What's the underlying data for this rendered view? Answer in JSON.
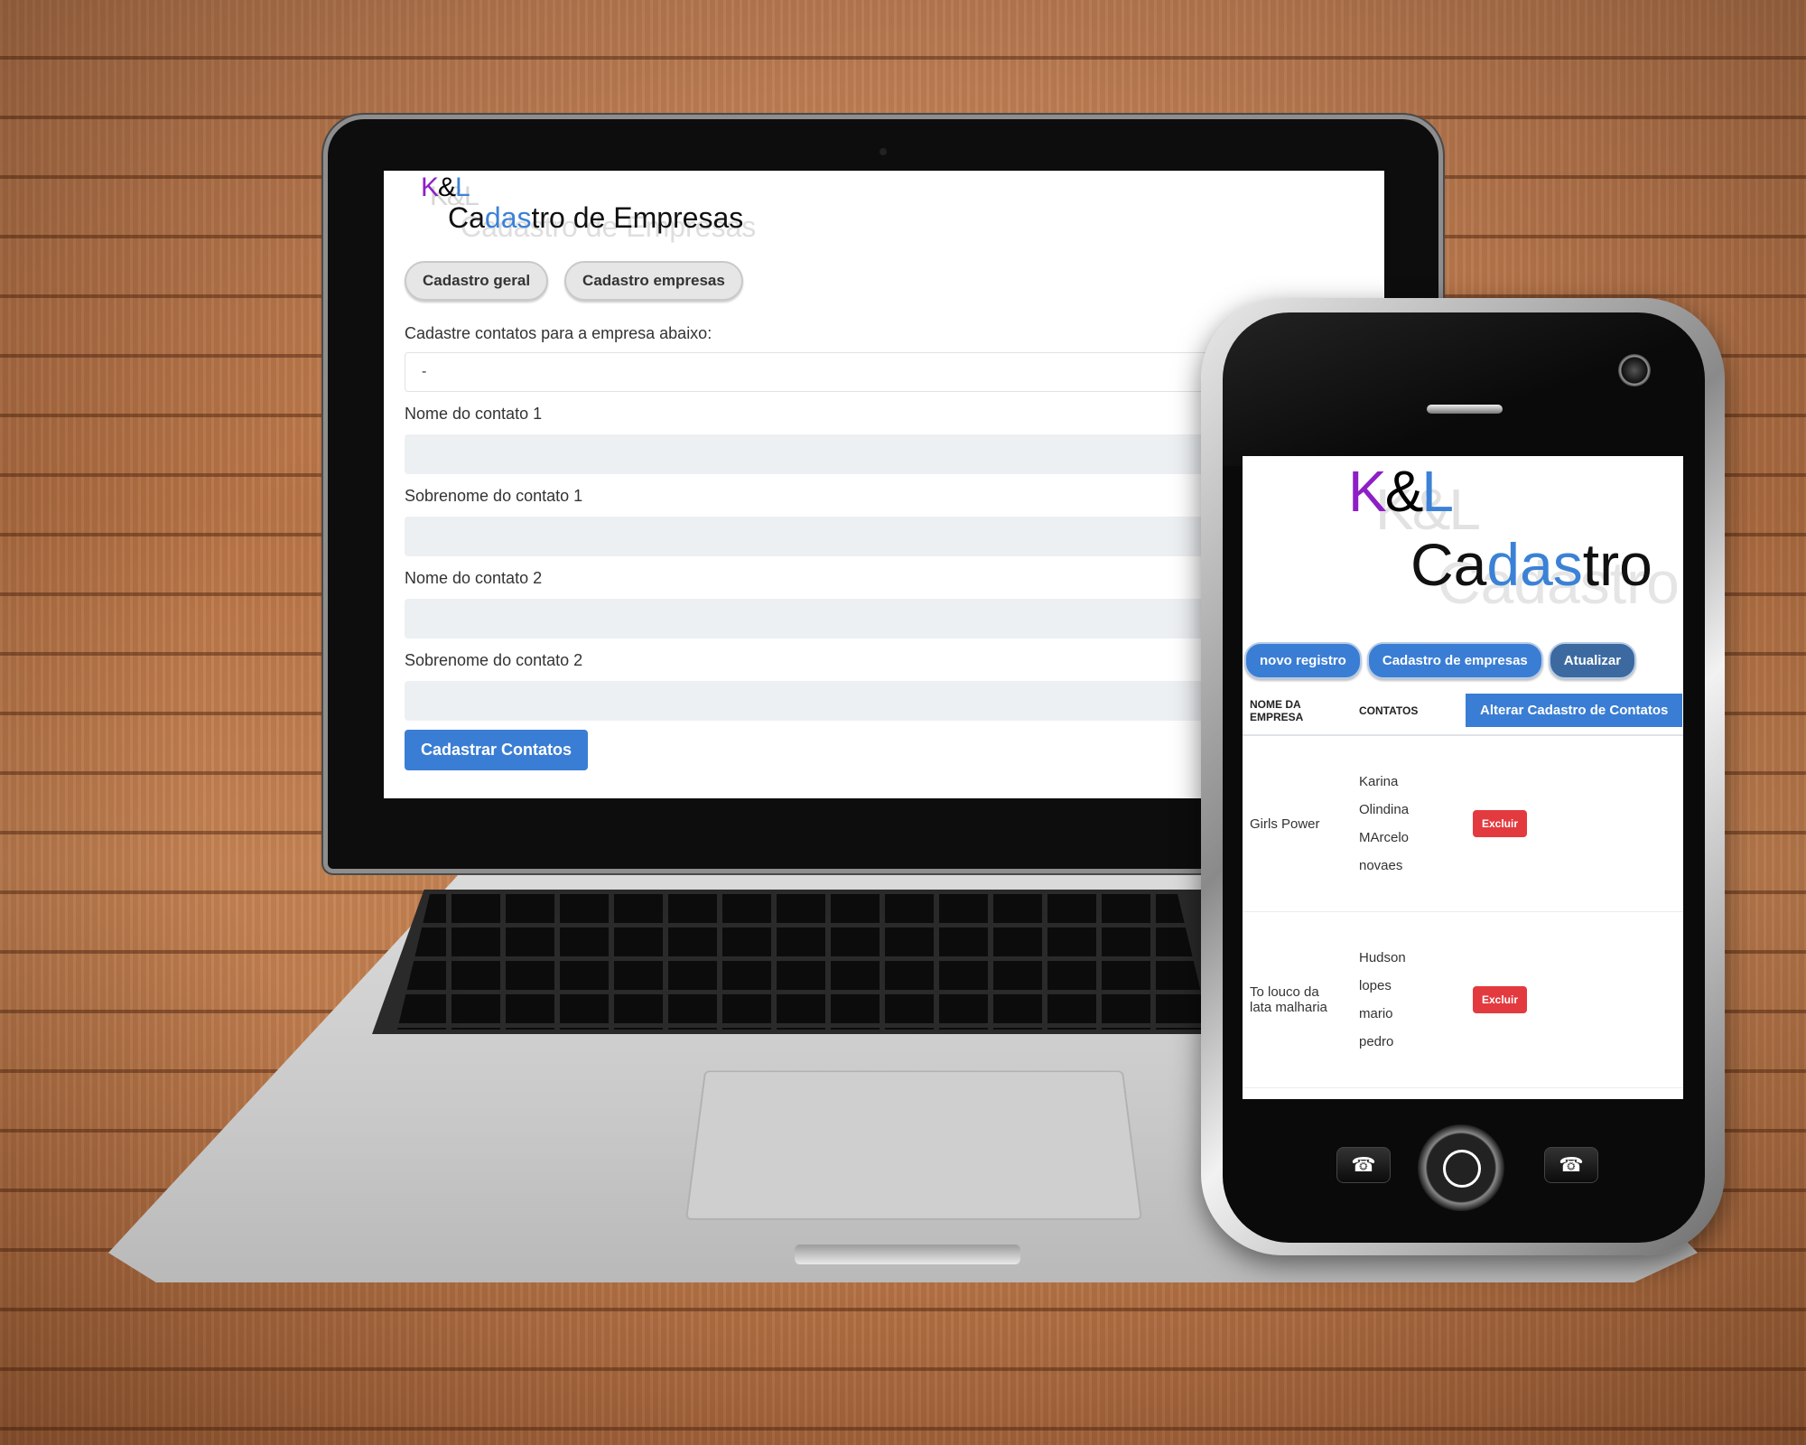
{
  "laptop_page": {
    "logo": {
      "k": "K",
      "amp": "&",
      "l": "L",
      "shadow": "K&L"
    },
    "title": {
      "part1": "Ca",
      "part2": "das",
      "part3": "tro de Empresas",
      "shadow": "Cadastro de Empresas"
    },
    "nav": [
      "Cadastro geral",
      "Cadastro empresas"
    ],
    "caption": "Cadastre contatos para a empresa abaixo:",
    "company_select_value": "-",
    "fields": [
      {
        "label": "Nome do contato 1",
        "value": ""
      },
      {
        "label": "Sobrenome do contato 1",
        "value": ""
      },
      {
        "label": "Nome do contato 2",
        "value": ""
      },
      {
        "label": "Sobrenome do contato 2",
        "value": ""
      }
    ],
    "submit_label": "Cadastrar Contatos"
  },
  "phone_page": {
    "logo": {
      "k": "K",
      "amp": "&",
      "l": "L",
      "shadow": "K&L"
    },
    "title": {
      "part1": "Ca",
      "part2": "das",
      "part3": "tro",
      "shadow": "Cadastro"
    },
    "nav": [
      "novo registro",
      "Cadastro de empresas",
      "Atualizar"
    ],
    "table": {
      "headers": [
        "NOME DA EMPRESA",
        "CONTATOS"
      ],
      "header_button": "Alterar Cadastro de Contatos",
      "rows": [
        {
          "company": "Girls Power",
          "contacts": [
            "Karina",
            "Olindina",
            "MArcelo",
            "novaes"
          ],
          "action": "Excluir"
        },
        {
          "company": "To louco da lata malharia",
          "contacts": [
            "Hudson",
            "lopes",
            "mario",
            "pedro"
          ],
          "action": "Excluir"
        }
      ]
    }
  },
  "colors": {
    "accent_blue": "#3a7dd4",
    "logo_purple": "#8e1fc6",
    "danger_red": "#e33a3f",
    "input_bg": "#edf0f3"
  },
  "icons": [
    "call-answer-icon",
    "home-button-icon",
    "call-end-icon"
  ]
}
